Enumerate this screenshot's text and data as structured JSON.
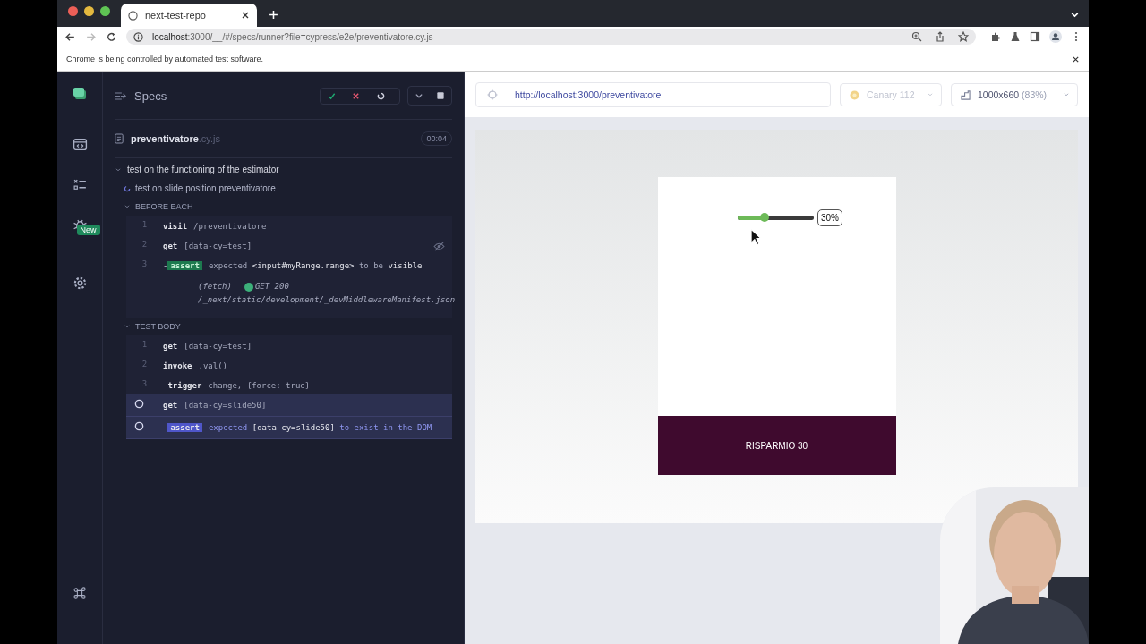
{
  "browser": {
    "tab_title": "next-test-repo",
    "url_host": "localhost",
    "url_rest": ":3000/__/#/specs/runner?file=cypress/e2e/preventivatore.cy.js",
    "infobar": "Chrome is being controlled by automated test software."
  },
  "sidebar": {
    "badge": "New"
  },
  "reporter": {
    "title": "Specs",
    "stats": [
      {
        "kind": "passed",
        "value": "--"
      },
      {
        "kind": "failed",
        "value": "--"
      },
      {
        "kind": "pending",
        "value": "--"
      }
    ],
    "spec_name": "preventivatore",
    "spec_ext": ".cy.js",
    "duration": "00:04",
    "suite": {
      "title": "test on the functioning of the estimator",
      "expanded": true
    },
    "test": "test on slide position preventivatore",
    "hooks": [
      {
        "title": "BEFORE EACH",
        "expanded": true,
        "commands": [
          {
            "kind": "command",
            "number": "1",
            "name": "visit",
            "message": "/preventivatore",
            "pending": false,
            "hidden": false
          },
          {
            "kind": "command",
            "number": "2",
            "name": "get",
            "message": "[data-cy=test]",
            "pending": false,
            "hidden": true
          },
          {
            "kind": "assert",
            "number": "3",
            "prefix": "-",
            "name": "assert",
            "message": "expected **<input#myRange.range>** to be **visible**",
            "pending": false,
            "hidden": false
          },
          {
            "kind": "fetch",
            "name": "(fetch)",
            "status": "GET 200",
            "message": "/_next/static/development/_devMiddlewareManifest.json",
            "pending": false,
            "hidden": false
          }
        ]
      },
      {
        "title": "TEST BODY",
        "expanded": true,
        "commands": [
          {
            "kind": "command",
            "number": "1",
            "name": "get",
            "message": "[data-cy=test]",
            "pending": false,
            "hidden": false
          },
          {
            "kind": "command",
            "number": "2",
            "name": "invoke",
            "message": ".val()",
            "pending": false,
            "hidden": false
          },
          {
            "kind": "command",
            "number": "3",
            "prefix": "-",
            "name": "trigger",
            "message": "change, {force: true}",
            "pending": false,
            "hidden": false
          },
          {
            "kind": "command",
            "name": "get",
            "message": "[data-cy=slide50]",
            "pending": true,
            "hidden": false
          },
          {
            "kind": "assert",
            "prefix": "-",
            "name": "assert",
            "message": "expected **[data-cy=slide50]** to exist in the DOM",
            "pending": true,
            "hidden": false
          }
        ]
      }
    ]
  },
  "aut": {
    "url": "http://localhost:3000/preventivatore",
    "browser": "Canary 112",
    "viewport": "1000x660",
    "scale": "(83%)",
    "slider": {
      "level": 0.35
    },
    "slider_value": "30%",
    "banner": "RISPARMIO 30"
  }
}
